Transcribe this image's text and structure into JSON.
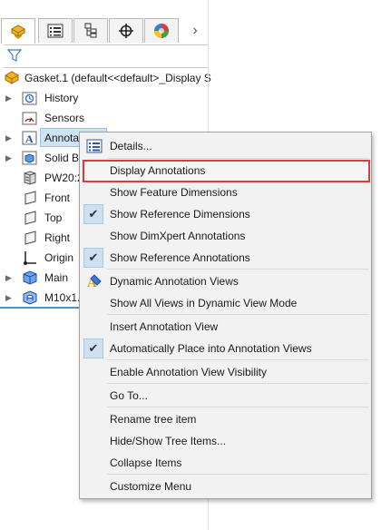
{
  "feature_manager": {
    "tabs": [
      {
        "icon": "feature-manager-tab-icon",
        "active": true
      },
      {
        "icon": "property-manager-tab-icon",
        "active": false
      },
      {
        "icon": "configuration-manager-tab-icon",
        "active": false
      },
      {
        "icon": "dimxpert-manager-tab-icon",
        "active": false
      },
      {
        "icon": "display-manager-tab-icon",
        "active": false
      }
    ],
    "more_tabs_glyph": "›",
    "root_label": "Gasket.1  (default<<default>_Display S",
    "tree_items": [
      {
        "label": "History",
        "icon": "history-folder-icon",
        "expandable": true
      },
      {
        "label": "Sensors",
        "icon": "sensors-icon",
        "expandable": false
      },
      {
        "label": "Annota",
        "icon": "annotations-icon",
        "expandable": true,
        "selected": true
      },
      {
        "label": "Solid B",
        "icon": "solid-bodies-icon",
        "expandable": true
      },
      {
        "label": "PW20:2",
        "icon": "material-icon",
        "expandable": false
      },
      {
        "label": "Front",
        "icon": "plane-icon",
        "expandable": false
      },
      {
        "label": "Top",
        "icon": "plane-icon",
        "expandable": false
      },
      {
        "label": "Right",
        "icon": "plane-icon",
        "expandable": false
      },
      {
        "label": "Origin",
        "icon": "origin-icon",
        "expandable": false
      },
      {
        "label": "Main",
        "icon": "feature-icon",
        "expandable": true
      },
      {
        "label": "M10x1.",
        "icon": "hole-feature-icon",
        "expandable": true
      }
    ]
  },
  "context_menu": {
    "items": [
      {
        "label": "Details...",
        "icon": "details-icon"
      },
      {
        "label": "Display Annotations",
        "highlighted": true
      },
      {
        "label": "Show Feature Dimensions"
      },
      {
        "label": "Show Reference Dimensions",
        "checked": true
      },
      {
        "label": "Show DimXpert Annotations"
      },
      {
        "label": "Show Reference Annotations",
        "checked": true
      },
      {
        "label": "Dynamic Annotation Views",
        "icon": "dynamic-annotation-views-icon"
      },
      {
        "label": "Show All Views in Dynamic View Mode"
      },
      {
        "label": "Insert Annotation View"
      },
      {
        "label": "Automatically Place into Annotation Views",
        "checked": true
      },
      {
        "label": "Enable Annotation View Visibility"
      },
      {
        "label": "Go To..."
      },
      {
        "label": "Rename tree item"
      },
      {
        "label": "Hide/Show Tree Items..."
      },
      {
        "label": "Collapse Items"
      },
      {
        "label": "Customize Menu"
      }
    ],
    "check_glyph": "✔",
    "highlight_color": "#e0393c"
  }
}
